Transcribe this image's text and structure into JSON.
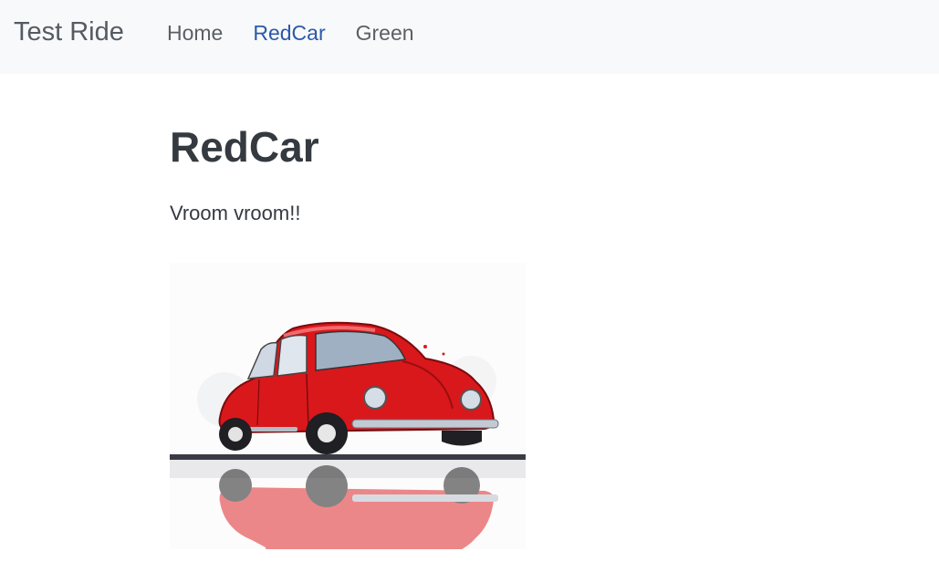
{
  "navbar": {
    "brand": "Test Ride",
    "links": [
      {
        "label": "Home",
        "active": false
      },
      {
        "label": "RedCar",
        "active": true
      },
      {
        "label": "Green",
        "active": false
      }
    ]
  },
  "main": {
    "title": "RedCar",
    "description": "Vroom vroom!!"
  },
  "image": {
    "subject": "red-vintage-car-illustration"
  },
  "colors": {
    "navbar_bg": "#f8f9fa",
    "active_link": "#2b5aa8",
    "text": "#343a40",
    "car_red": "#d9181c"
  }
}
